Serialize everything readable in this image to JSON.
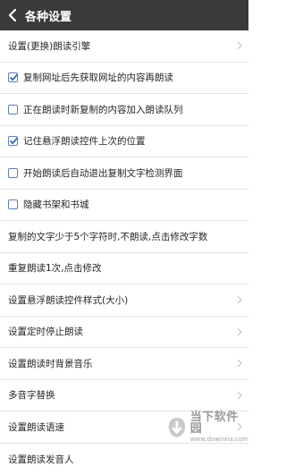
{
  "header": {
    "title": "各种设置"
  },
  "settings": [
    {
      "label": "设置(更换)朗读引擎",
      "type": "nav"
    },
    {
      "label": "复制网址后先获取网址的内容再朗读",
      "type": "checkbox",
      "checked": true
    },
    {
      "label": "正在朗读时新复制的内容加入朗读队列",
      "type": "checkbox",
      "checked": false
    },
    {
      "label": "记住悬浮朗读控件上次的位置",
      "type": "checkbox",
      "checked": true
    },
    {
      "label": "开始朗读后自动退出复制文字检测界面",
      "type": "checkbox",
      "checked": false
    },
    {
      "label": "隐藏书架和书城",
      "type": "checkbox",
      "checked": false
    },
    {
      "label": "复制的文字少于5个字符时,不朗读,点击修改字数",
      "type": "plain"
    },
    {
      "label": "重复朗读1次,点击修改",
      "type": "plain"
    },
    {
      "label": "设置悬浮朗读控件样式(大小)",
      "type": "nav"
    },
    {
      "label": "设置定时停止朗读",
      "type": "nav"
    },
    {
      "label": "设置朗读时背景音乐",
      "type": "nav"
    },
    {
      "label": "多音字替换",
      "type": "nav"
    },
    {
      "label": "设置朗读语速",
      "type": "nav"
    },
    {
      "label": "设置朗读发音人",
      "type": "nav"
    }
  ],
  "watermark": {
    "name": "当下软件园",
    "url": "www.downxia.com"
  },
  "colors": {
    "header_bg": "#3a3a3a",
    "checkbox_border": "#5b7fb8",
    "check_mark": "#2f5fa8"
  }
}
